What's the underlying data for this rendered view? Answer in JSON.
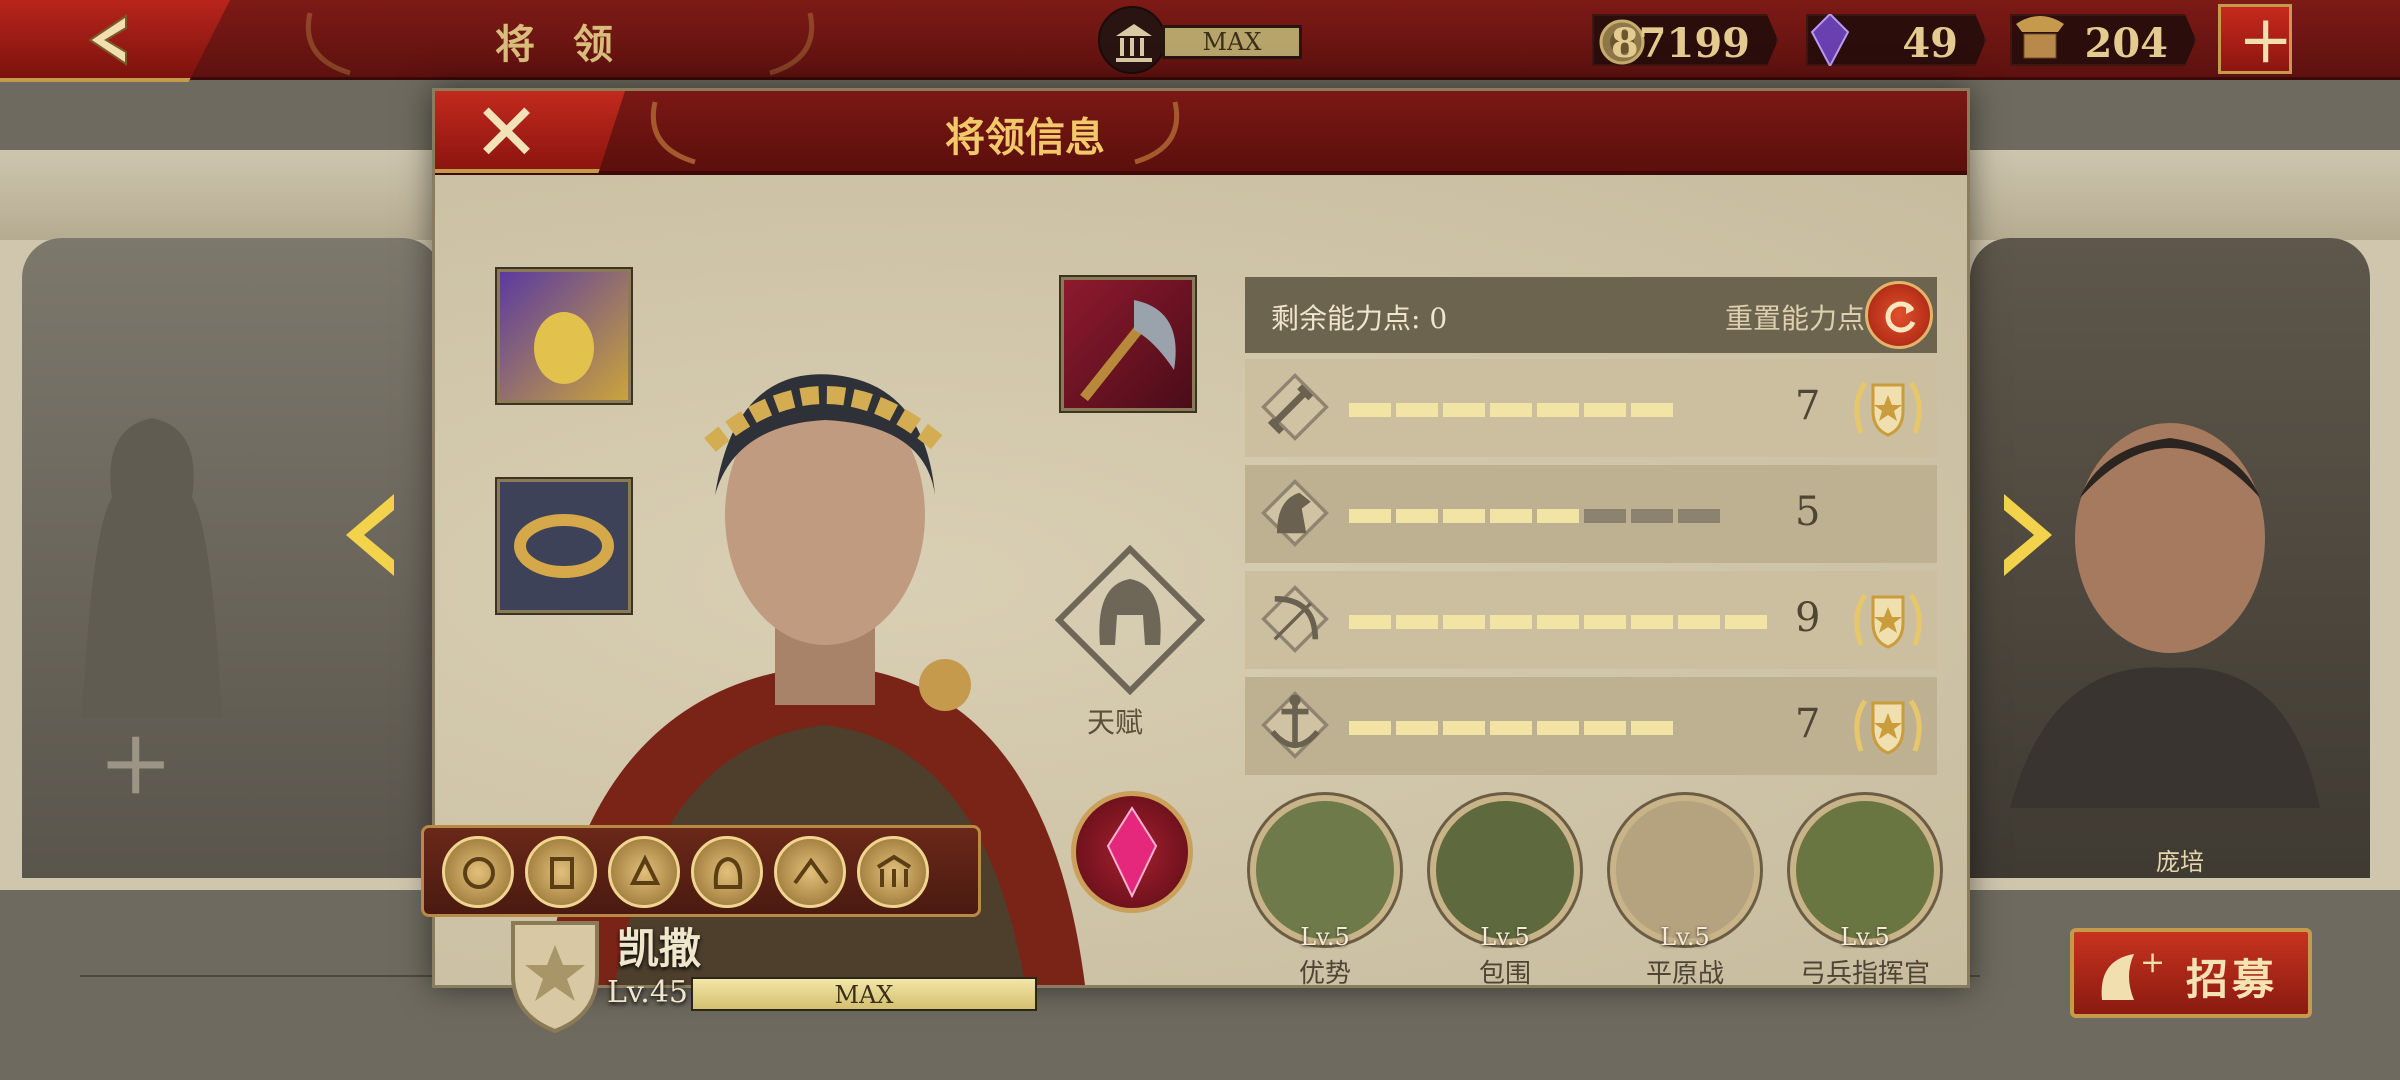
{
  "topbar": {
    "title": "将 领",
    "level_label": "MAX",
    "resources": [
      {
        "name": "gold",
        "icon": "coin-icon",
        "value": "87199"
      },
      {
        "name": "gem",
        "icon": "purple-gem-icon",
        "value": "49"
      },
      {
        "name": "spqr",
        "icon": "eagle-banner-icon",
        "value": "204"
      }
    ]
  },
  "gallery": {
    "right_general_name": "庞培",
    "recruit_label": "招募"
  },
  "modal": {
    "title": "将领信息",
    "talent_label": "天赋",
    "hero": {
      "name": "凯撒",
      "level": "Lv.45",
      "xp_label": "MAX",
      "xp_fraction": 1.0
    },
    "stats": {
      "remaining_label": "剩余能力点: 0",
      "reset_label": "重置能力点",
      "rows": [
        {
          "icon": "sword-icon",
          "value": "7",
          "filled": 7,
          "total": 7,
          "badge": true
        },
        {
          "icon": "horse-icon",
          "value": "5",
          "filled": 5,
          "total": 8,
          "badge": false
        },
        {
          "icon": "bow-icon",
          "value": "9",
          "filled": 9,
          "total": 9,
          "badge": true
        },
        {
          "icon": "anchor-icon",
          "value": "7",
          "filled": 7,
          "total": 7,
          "badge": true
        }
      ]
    },
    "tactics": [
      {
        "level": "Lv.5",
        "name": "优势"
      },
      {
        "level": "Lv.5",
        "name": "包围"
      },
      {
        "level": "Lv.5",
        "name": "平原战"
      },
      {
        "level": "Lv.5",
        "name": "弓兵指挥官"
      }
    ]
  },
  "colors": {
    "accent_red": "#7b1814",
    "gold": "#c69a4c",
    "bar_on": "#f1e4a5"
  }
}
